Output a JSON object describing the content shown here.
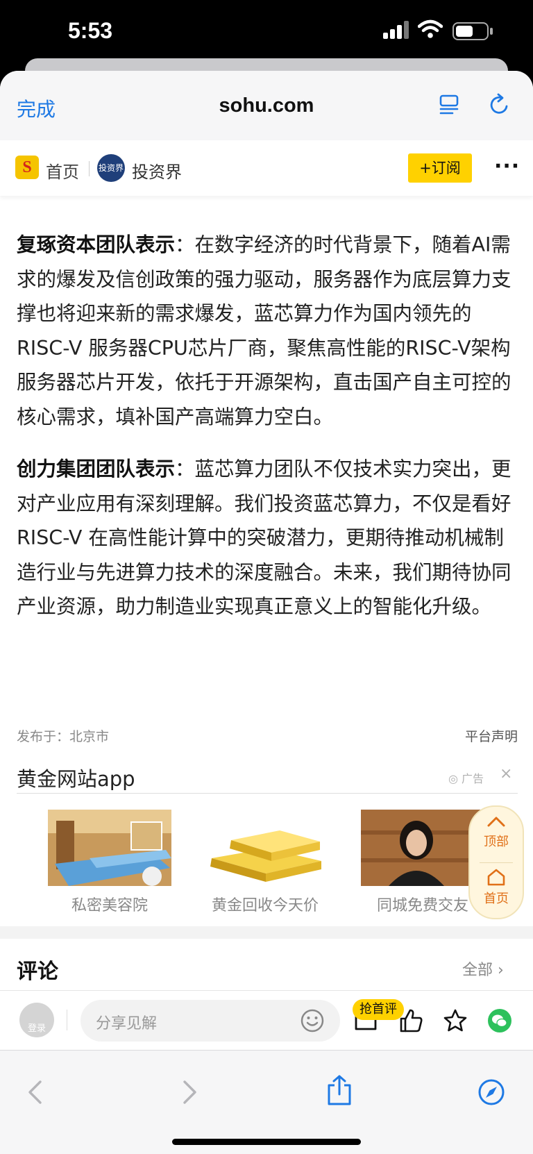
{
  "status": {
    "time": "5:53"
  },
  "browser": {
    "done_label": "完成",
    "url": "sohu.com",
    "reader_icon": "reader-icon",
    "reload_icon": "reload-icon"
  },
  "site_nav": {
    "logo_letter": "S",
    "home_label": "首页",
    "channel_logo_text": "投资界",
    "channel_name": "投资界",
    "subscribe_label": "+订阅",
    "more_label": "···"
  },
  "article": {
    "p1_lead": "复琢资本团队表示",
    "p1_text": "：在数字经济的时代背景下，随着AI需求的爆发及信创政策的强力驱动，服务器作为底层算力支撑也将迎来新的需求爆发，蓝芯算力作为国内领先的RISC-V 服务器CPU芯片厂商，聚焦高性能的RISC-V架构服务器芯片开发，依托于开源架构，直击国产自主可控的核心需求，填补国产高端算力空白。",
    "p2_lead": "创力集团团队表示",
    "p2_text": "：蓝芯算力团队不仅技术实力突出，更对产业应用有深刻理解。我们投资蓝芯算力，不仅是看好RISC-V 在高性能计算中的突破潜力，更期待推动机械制造行业与先进算力技术的深度融合。未来，我们期待协同产业资源，助力制造业实现真正意义上的智能化升级。"
  },
  "meta": {
    "published": "发布于：北京市",
    "platform_statement": "平台声明"
  },
  "ad": {
    "title": "黄金网站app",
    "badge": "广告",
    "close": "×",
    "items": [
      {
        "caption": "私密美容院"
      },
      {
        "caption": "黄金回收今天价"
      },
      {
        "caption": "同城免费交友"
      }
    ]
  },
  "float_nav": {
    "top_label": "顶部",
    "home_label": "首页"
  },
  "comments": {
    "title": "评论",
    "all_label": "全部"
  },
  "action_bar": {
    "avatar_label": "登录",
    "input_placeholder": "分享见解",
    "first_comment_badge": "抢首评"
  },
  "colors": {
    "accent_blue": "#1e79e4",
    "brand_yellow": "#ffd100",
    "float_orange": "#e07018",
    "wechat_green": "#2dc15c"
  }
}
